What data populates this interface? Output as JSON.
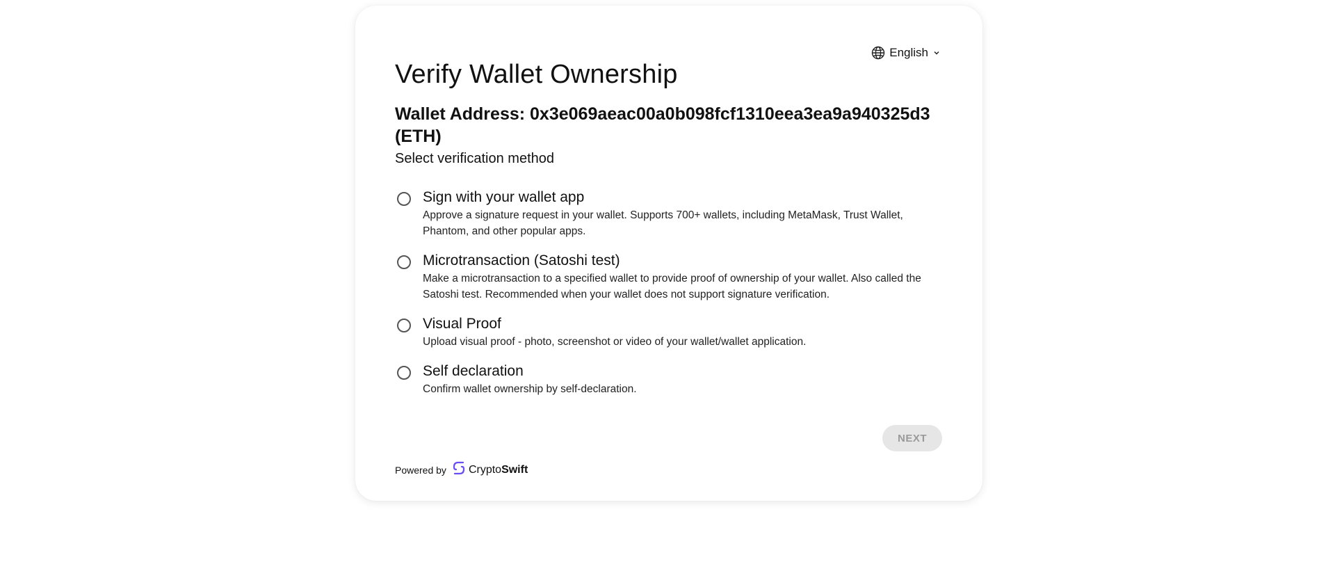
{
  "header": {
    "language": "English",
    "title": "Verify Wallet Ownership",
    "wallet_address": "Wallet Address: 0x3e069aeac00a0b098fcf1310eea3ea9a940325d3 (ETH)"
  },
  "main": {
    "select_label": "Select verification method",
    "options": [
      {
        "title": "Sign with your wallet app",
        "description": "Approve a signature request in your wallet. Supports 700+ wallets, including MetaMask, Trust Wallet, Phantom, and other popular apps.",
        "selected": false
      },
      {
        "title": "Microtransaction (Satoshi test)",
        "description": "Make a microtransaction to a specified wallet to provide proof of ownership of your wallet. Also called the Satoshi test. Recommended when your wallet does not support signature verification.",
        "selected": false
      },
      {
        "title": "Visual Proof",
        "description": "Upload visual proof - photo, screenshot or video of your wallet/wallet application.",
        "selected": false
      },
      {
        "title": "Self declaration",
        "description": "Confirm wallet ownership by self-declaration.",
        "selected": false
      }
    ],
    "next_label": "NEXT"
  },
  "footer": {
    "powered_by": "Powered by",
    "brand_part1": "Crypto",
    "brand_part2": "Swift"
  },
  "colors": {
    "brand_logo": "#6a4cf5",
    "button_disabled_bg": "#e6e6e6",
    "button_disabled_text": "#9a9a9a"
  },
  "icons": {
    "language": "globe-icon",
    "dropdown": "chevron-down-icon",
    "brand": "cryptoswift-logo-icon"
  }
}
